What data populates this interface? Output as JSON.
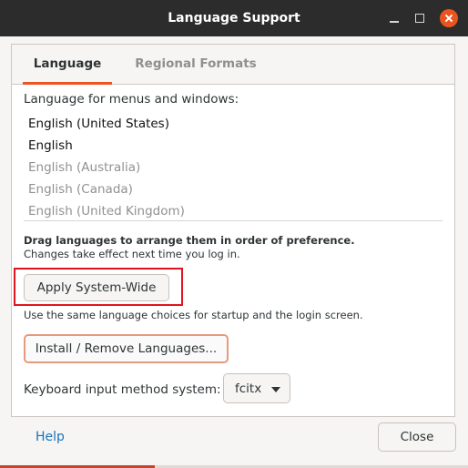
{
  "window": {
    "title": "Language Support",
    "accent_color": "#e95420"
  },
  "tabs": [
    {
      "label": "Language",
      "active": true
    },
    {
      "label": "Regional Formats",
      "active": false
    }
  ],
  "language_section": {
    "label": "Language for menus and windows:",
    "languages": [
      {
        "name": "English (United States)",
        "enabled": true
      },
      {
        "name": "English",
        "enabled": true
      },
      {
        "name": "English (Australia)",
        "enabled": false
      },
      {
        "name": "English (Canada)",
        "enabled": false
      },
      {
        "name": "English (United Kingdom)",
        "enabled": false
      }
    ],
    "drag_hint": "Drag languages to arrange them in order of preference.",
    "changes_note": "Changes take effect next time you log in."
  },
  "buttons": {
    "apply": "Apply System-Wide",
    "apply_note": "Use the same language choices for startup and the login screen.",
    "install": "Install / Remove Languages...",
    "help": "Help",
    "close": "Close"
  },
  "keyboard": {
    "label": "Keyboard input method system:",
    "value": "fcitx"
  },
  "icons": {
    "minimize": "minimize-icon",
    "maximize": "maximize-icon",
    "close": "close-icon",
    "dropdown": "chevron-down-icon"
  },
  "highlight_color": "#e0141c"
}
